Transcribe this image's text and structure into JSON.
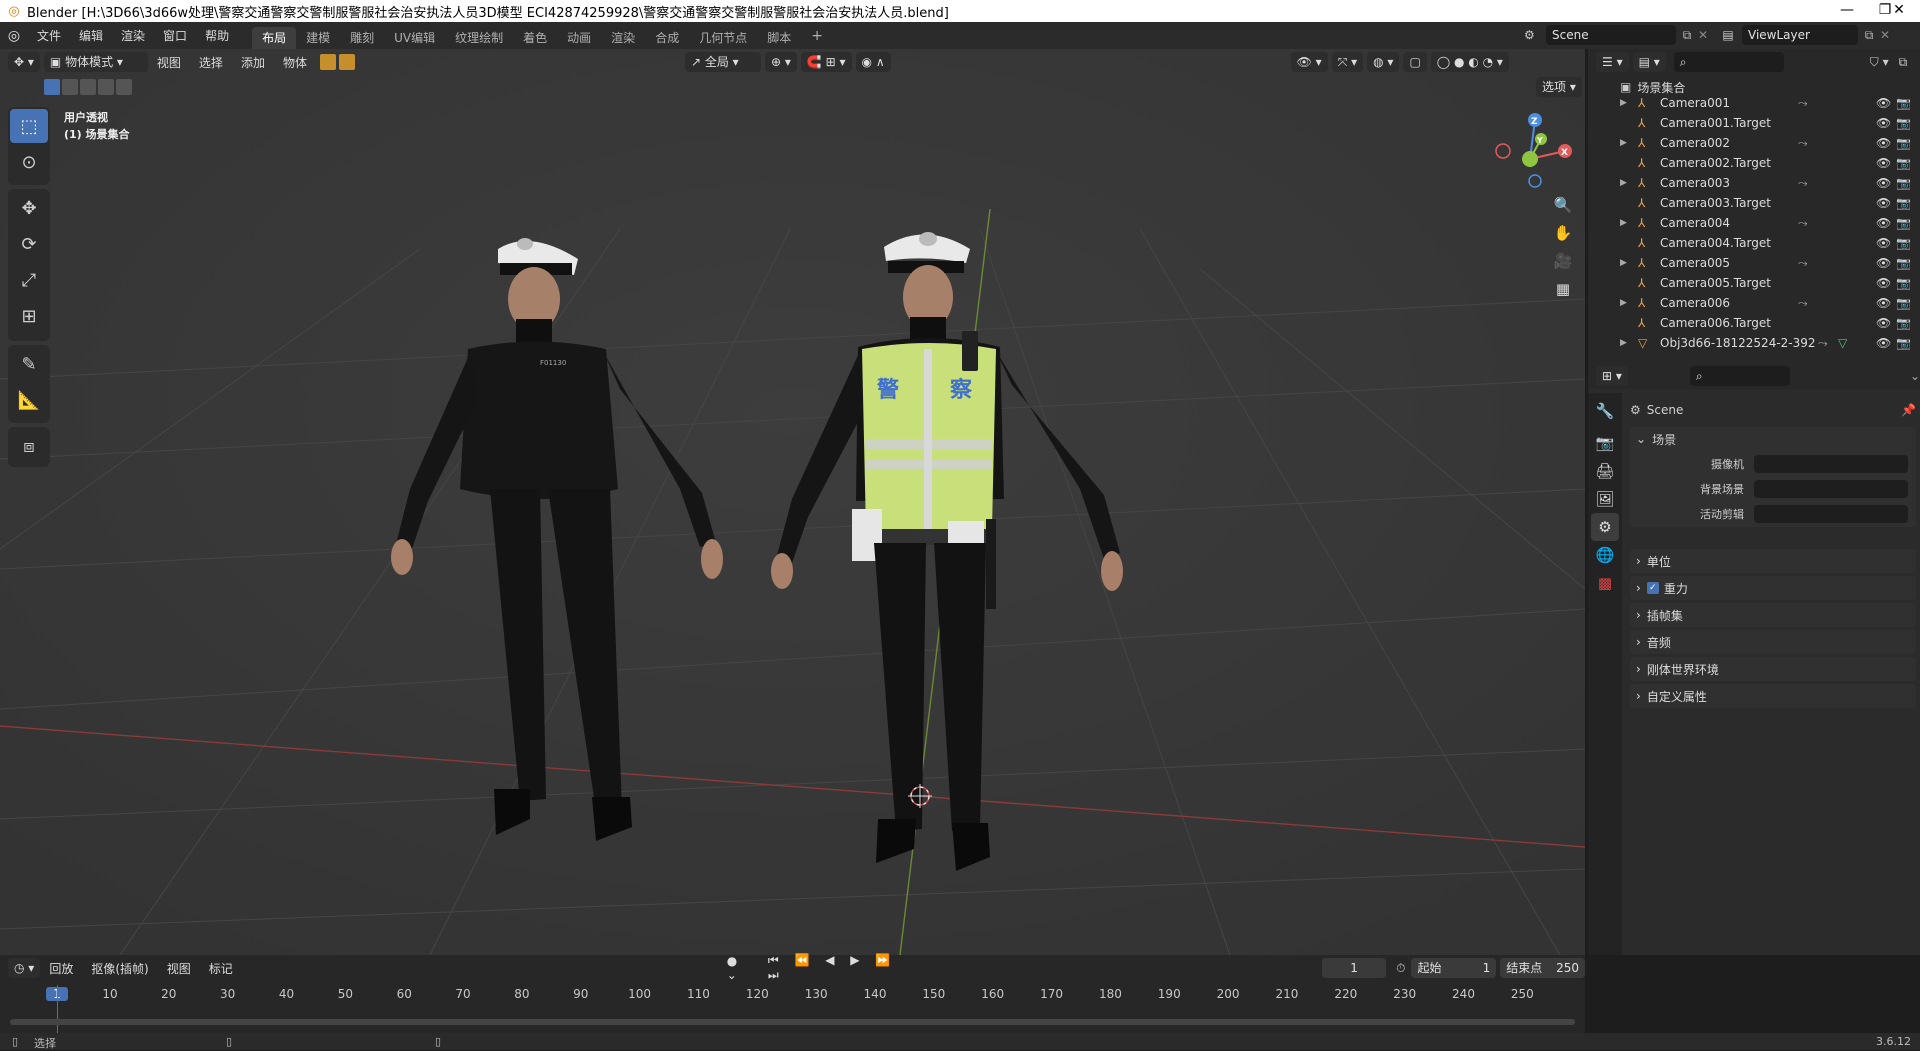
{
  "titlebar": {
    "title": "Blender [H:\\3D66\\3d66w处理\\警察交通警察交警制服警服社会治安执法人员3D模型 ECI42874259928\\警察交通警察交警制服警服社会治安执法人员.blend]",
    "minimize": "—",
    "maximize": "❐",
    "close": "✕"
  },
  "menubar": {
    "items": [
      "文件",
      "编辑",
      "渲染",
      "窗口",
      "帮助"
    ],
    "workspaces": [
      "布局",
      "建模",
      "雕刻",
      "UV编辑",
      "纹理绘制",
      "着色",
      "动画",
      "渲染",
      "合成",
      "几何节点",
      "脚本"
    ],
    "active_workspace": "布局",
    "add_tab": "+",
    "scene": "Scene",
    "view_layer": "ViewLayer"
  },
  "viewport_header": {
    "mode": "物体模式",
    "menus": [
      "视图",
      "选择",
      "添加",
      "物体"
    ],
    "orientation": "全局",
    "options": "选项"
  },
  "viewport": {
    "overlay_title": "用户透视",
    "overlay_collection": "(1) 场景集合",
    "vest_text": [
      "警",
      "察"
    ],
    "chest_badge": "F01130",
    "gizmo_axes": {
      "x": "X",
      "y": "Y",
      "z": "Z"
    },
    "colors": {
      "x_axis": "#e35a5a",
      "y_axis": "#8fc641",
      "z_axis": "#4c8fe0",
      "select": "#4772b3"
    }
  },
  "outliner": {
    "root": "场景集合",
    "items": [
      {
        "name": "Camera001",
        "expandable": true,
        "constraint": true
      },
      {
        "name": "Camera001.Target",
        "expandable": false,
        "constraint": false
      },
      {
        "name": "Camera002",
        "expandable": true,
        "constraint": true
      },
      {
        "name": "Camera002.Target",
        "expandable": false,
        "constraint": false
      },
      {
        "name": "Camera003",
        "expandable": true,
        "constraint": true
      },
      {
        "name": "Camera003.Target",
        "expandable": false,
        "constraint": false
      },
      {
        "name": "Camera004",
        "expandable": true,
        "constraint": true
      },
      {
        "name": "Camera004.Target",
        "expandable": false,
        "constraint": false
      },
      {
        "name": "Camera005",
        "expandable": true,
        "constraint": true
      },
      {
        "name": "Camera005.Target",
        "expandable": false,
        "constraint": false
      },
      {
        "name": "Camera006",
        "expandable": true,
        "constraint": true
      },
      {
        "name": "Camera006.Target",
        "expandable": false,
        "constraint": false
      },
      {
        "name": "Obj3d66-18122524-2-392",
        "expandable": true,
        "constraint": true
      }
    ]
  },
  "properties": {
    "header": "Scene",
    "section": "场景",
    "fields": [
      {
        "label": "摄像机",
        "value": ""
      },
      {
        "label": "背景场景",
        "value": ""
      },
      {
        "label": "活动剪辑",
        "value": ""
      }
    ],
    "panels": [
      {
        "label": "单位",
        "checkbox": false
      },
      {
        "label": "重力",
        "checkbox": true
      },
      {
        "label": "插帧集",
        "checkbox": false
      },
      {
        "label": "音频",
        "checkbox": false
      },
      {
        "label": "刚体世界环境",
        "checkbox": false
      },
      {
        "label": "自定义属性",
        "checkbox": false
      }
    ]
  },
  "timeline": {
    "menus": [
      "回放",
      "抠像(插帧)",
      "视图",
      "标记"
    ],
    "current_frame": "1",
    "start_label": "起始",
    "start": "1",
    "end_label": "结束点",
    "end": "250",
    "ticks": [
      "1",
      "10",
      "20",
      "30",
      "40",
      "50",
      "60",
      "70",
      "80",
      "90",
      "100",
      "110",
      "120",
      "130",
      "140",
      "150",
      "160",
      "170",
      "180",
      "190",
      "200",
      "210",
      "220",
      "230",
      "240",
      "250"
    ]
  },
  "statusbar": {
    "select": "选择",
    "version": "3.6.12"
  }
}
